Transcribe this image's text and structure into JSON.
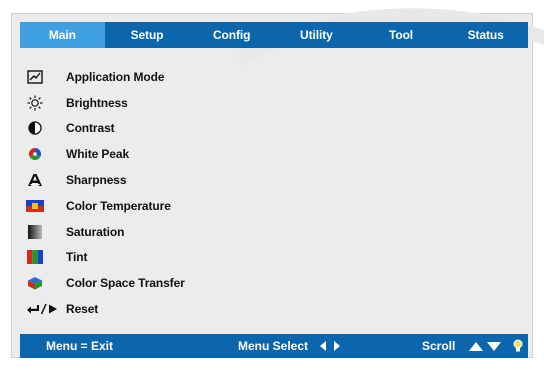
{
  "tabs": [
    {
      "label": "Main",
      "active": true
    },
    {
      "label": "Setup",
      "active": false
    },
    {
      "label": "Config",
      "active": false
    },
    {
      "label": "Utility",
      "active": false
    },
    {
      "label": "Tool",
      "active": false
    },
    {
      "label": "Status",
      "active": false
    }
  ],
  "items": [
    {
      "label": "Application Mode",
      "icon": "application-mode-icon"
    },
    {
      "label": "Brightness",
      "icon": "brightness-icon"
    },
    {
      "label": "Contrast",
      "icon": "contrast-icon"
    },
    {
      "label": "White Peak",
      "icon": "white-peak-icon"
    },
    {
      "label": "Sharpness",
      "icon": "sharpness-icon"
    },
    {
      "label": "Color Temperature",
      "icon": "color-temperature-icon"
    },
    {
      "label": "Saturation",
      "icon": "saturation-icon"
    },
    {
      "label": "Tint",
      "icon": "tint-icon"
    },
    {
      "label": "Color Space Transfer",
      "icon": "color-space-transfer-icon"
    },
    {
      "label": "Reset",
      "icon": "reset-icon"
    }
  ],
  "footer": {
    "menu_exit": "Menu = Exit",
    "menu_select": "Menu Select",
    "scroll": "Scroll"
  },
  "colors": {
    "menubar": "#0b66ad",
    "active_tab": "#3ea0e0",
    "panel": "#ececec"
  }
}
